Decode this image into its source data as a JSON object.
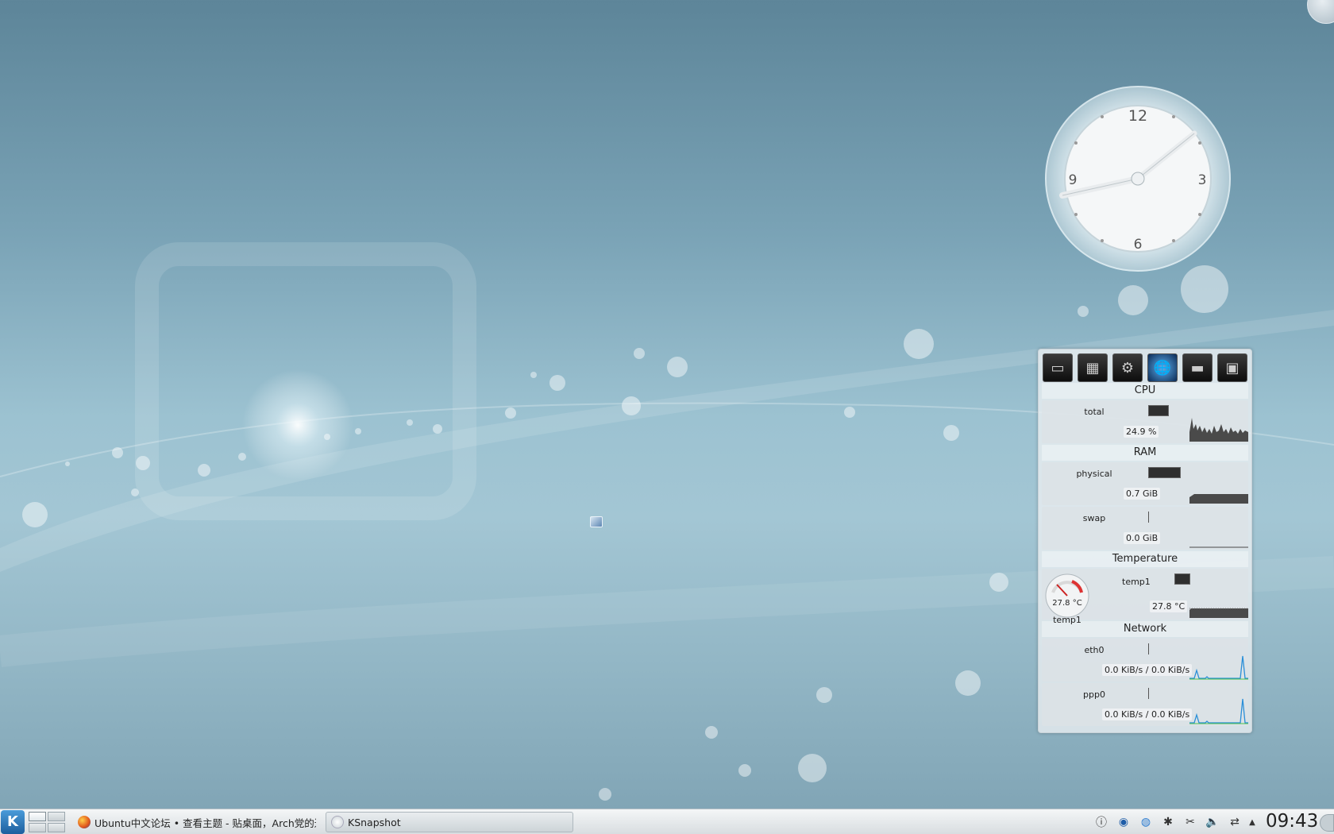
{
  "clock": {
    "numbers": [
      "12",
      "3",
      "6",
      "9"
    ],
    "time": "09:43"
  },
  "monitor": {
    "device_icons": [
      "hard-disk-icon",
      "hard-disk-2-icon",
      "hardware-icon",
      "network-globe-icon",
      "graphics-card-icon",
      "cpu-chip-icon"
    ],
    "cpu": {
      "title": "CPU",
      "label": "total",
      "value": "24.9 %",
      "fraction": 0.249
    },
    "ram": {
      "title": "RAM",
      "physical": {
        "label": "physical",
        "value": "0.7 GiB",
        "fraction": 0.5
      },
      "swap": {
        "label": "swap",
        "value": "0.0 GiB",
        "fraction": 0
      }
    },
    "temperature": {
      "title": "Temperature",
      "label": "temp1",
      "value": "27.8 °C",
      "gauge_value": "27.8 °C",
      "gauge_label": "temp1"
    },
    "network": {
      "title": "Network",
      "eth0": {
        "label": "eth0",
        "value": "0.0 KiB/s / 0.0 KiB/s"
      },
      "ppp0": {
        "label": "ppp0",
        "value": "0.0 KiB/s / 0.0 KiB/s"
      }
    }
  },
  "taskbar": {
    "kmenu_label": "K",
    "tasks": [
      {
        "label": "Ubuntu中文论坛 • 查看主题 - 贴桌面，Arch党的进步",
        "icon": "firefox-icon"
      },
      {
        "label": "KSnapshot",
        "icon": "ksnapshot-icon"
      }
    ],
    "tray_icons": [
      "info-icon",
      "network-manager-icon",
      "globe-icon",
      "bluetooth-icon",
      "scissors-icon",
      "volume-icon",
      "network-icon",
      "expand-arrow-icon"
    ],
    "time": "09:43"
  },
  "colors": {
    "wallpaper": "#8fb4c4",
    "graph_fill": "#4a4a4a",
    "network_line": "#2a8fd8",
    "network_line2": "#4cc24c"
  }
}
